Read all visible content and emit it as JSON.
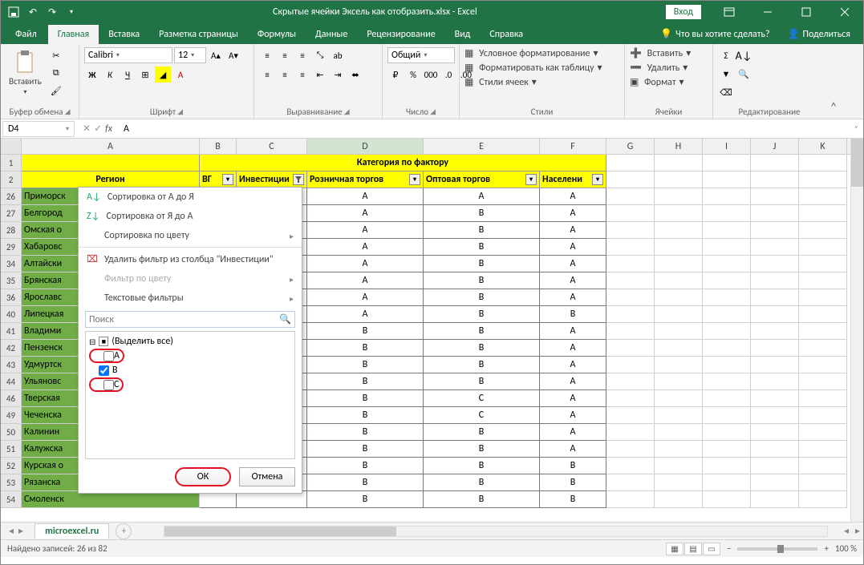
{
  "titlebar": {
    "title": "Скрытые ячейки Эксель как отобразить.xlsx - Excel",
    "login": "Вход"
  },
  "tabs": {
    "file": "Файл",
    "home": "Главная",
    "insert": "Вставка",
    "pagelayout": "Разметка страницы",
    "formulas": "Формулы",
    "data": "Данные",
    "review": "Рецензирование",
    "view": "Вид",
    "help": "Справка",
    "tellme": "Что вы хотите сделать?",
    "share": "Поделиться"
  },
  "ribbon": {
    "clipboard": {
      "label": "Буфер обмена",
      "paste": "Вставить"
    },
    "font": {
      "label": "Шрифт",
      "family": "Calibri",
      "size": "12",
      "bold": "Ж",
      "italic": "К",
      "underline": "Ч"
    },
    "alignment": {
      "label": "Выравнивание"
    },
    "number": {
      "label": "Число",
      "format": "Общий"
    },
    "styles": {
      "label": "Стили",
      "cond": "Условное форматирование",
      "table": "Форматировать как таблицу",
      "cell": "Стили ячеек"
    },
    "cells": {
      "label": "Ячейки",
      "insert": "Вставить",
      "delete": "Удалить",
      "format": "Формат"
    },
    "editing": {
      "label": "Редактирование"
    }
  },
  "fxbar": {
    "name": "D4",
    "value": "A"
  },
  "cols": [
    "A",
    "B",
    "C",
    "D",
    "E",
    "F",
    "G",
    "H",
    "I",
    "J",
    "K"
  ],
  "header": {
    "region": "Регион",
    "category": "Категория по фактору",
    "b": "ВГ",
    "c": "Инвестиции",
    "d": "Розничная торгов",
    "e": "Оптовая торгов",
    "f": "Населени"
  },
  "rows": [
    {
      "n": 26,
      "a": "Приморск",
      "d": "A",
      "e": "A",
      "f": "A"
    },
    {
      "n": 27,
      "a": "Белгород",
      "d": "A",
      "e": "B",
      "f": "A"
    },
    {
      "n": 28,
      "a": "Омская о",
      "d": "A",
      "e": "B",
      "f": "A"
    },
    {
      "n": 29,
      "a": "Хабаровс",
      "d": "A",
      "e": "B",
      "f": "A"
    },
    {
      "n": 34,
      "a": "Алтайски",
      "d": "A",
      "e": "B",
      "f": "A"
    },
    {
      "n": 35,
      "a": "Брянская",
      "d": "A",
      "e": "B",
      "f": "A"
    },
    {
      "n": 36,
      "a": "Ярославс",
      "d": "A",
      "e": "B",
      "f": "A"
    },
    {
      "n": 40,
      "a": "Липецкая",
      "d": "A",
      "e": "B",
      "f": "B"
    },
    {
      "n": 41,
      "a": "Владими",
      "d": "B",
      "e": "B",
      "f": "A"
    },
    {
      "n": 42,
      "a": "Пензенск",
      "d": "B",
      "e": "B",
      "f": "A"
    },
    {
      "n": 43,
      "a": "Удмуртск",
      "d": "B",
      "e": "B",
      "f": "A"
    },
    {
      "n": 44,
      "a": "Ульяновс",
      "d": "B",
      "e": "B",
      "f": "A"
    },
    {
      "n": 46,
      "a": "Тверская",
      "d": "B",
      "e": "C",
      "f": "A"
    },
    {
      "n": 49,
      "a": "Чеченска",
      "d": "B",
      "e": "C",
      "f": "A"
    },
    {
      "n": 50,
      "a": "Калинин",
      "d": "B",
      "e": "B",
      "f": "A"
    },
    {
      "n": 51,
      "a": "Калужска",
      "d": "B",
      "e": "B",
      "f": "A"
    },
    {
      "n": 52,
      "a": "Курская о",
      "d": "B",
      "e": "B",
      "f": "B"
    },
    {
      "n": 53,
      "a": "Рязанска",
      "d": "B",
      "e": "B",
      "f": "B"
    },
    {
      "n": 54,
      "a": "Смоленск",
      "d": "B",
      "e": "B",
      "f": "B"
    }
  ],
  "filter": {
    "sort_az": "Сортировка от А до Я",
    "sort_za": "Сортировка от Я до А",
    "sort_color": "Сортировка по цвету",
    "clear": "Удалить фильтр из столбца \"Инвестиции\"",
    "color_filter": "Фильтр по цвету",
    "text_filters": "Текстовые фильтры",
    "search": "Поиск",
    "select_all": "(Выделить все)",
    "opts": [
      "A",
      "B",
      "C"
    ],
    "ok": "ОК",
    "cancel": "Отмена"
  },
  "sheets": {
    "tab": "microexcel.ru"
  },
  "status": {
    "left": "Найдено записей: 26 из 82",
    "zoom": "100 %"
  }
}
